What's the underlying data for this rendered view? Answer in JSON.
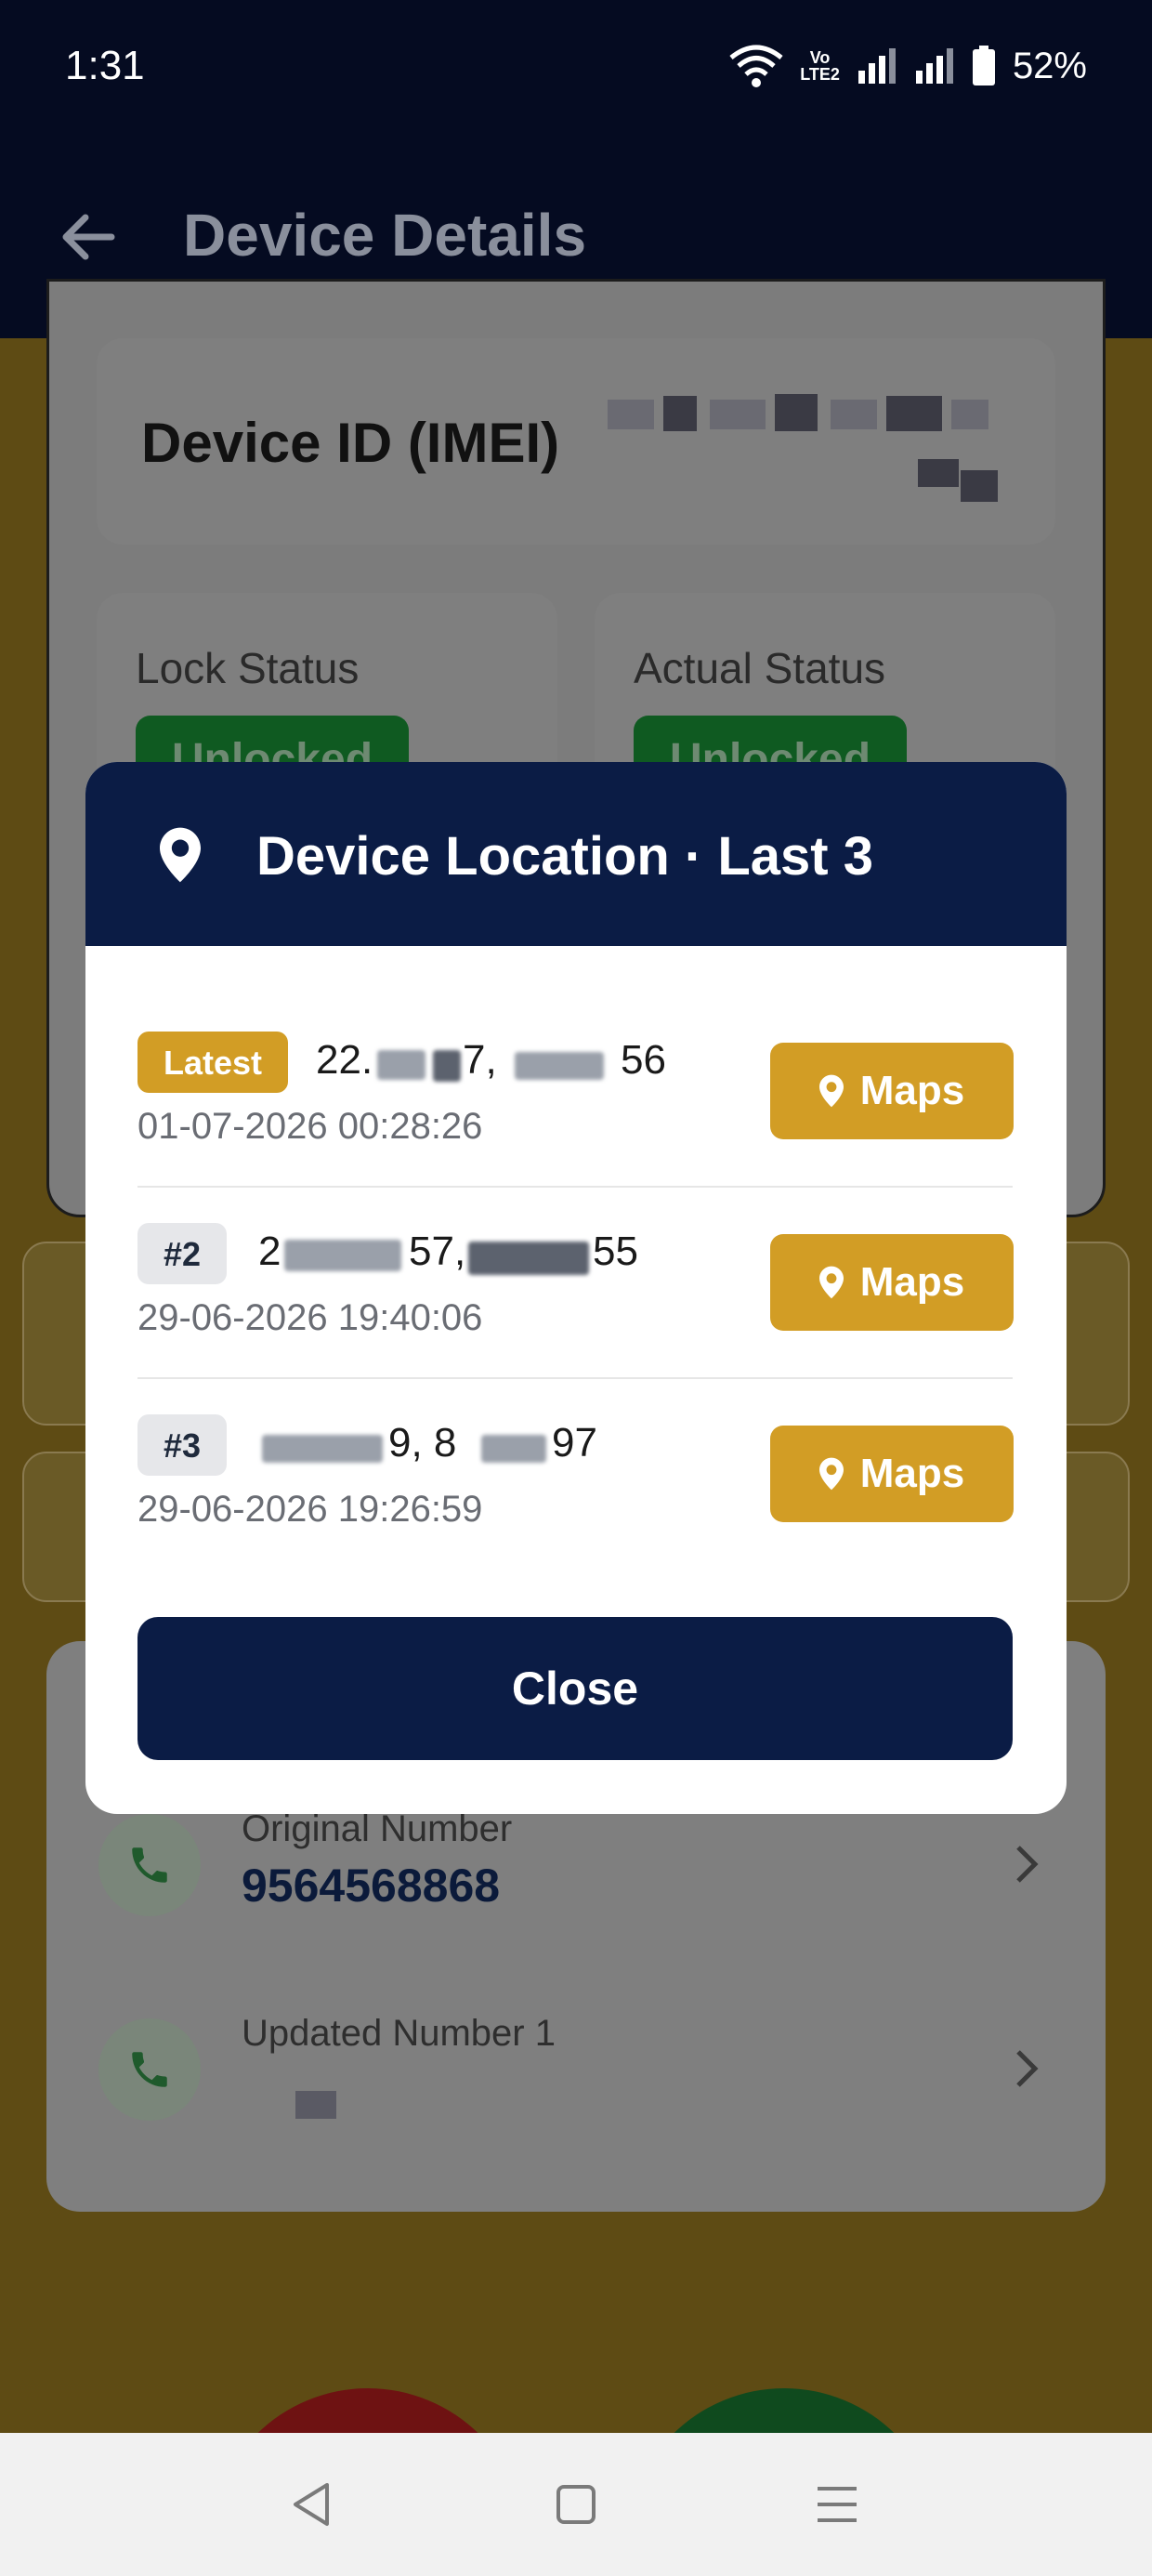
{
  "status_bar": {
    "time": "1:31",
    "battery": "52%",
    "network_label_top": "Vo",
    "network_label_bottom": "LTE2"
  },
  "app_bar": {
    "title": "Device Details",
    "back_icon": "arrow-back-icon"
  },
  "device": {
    "imei_label": "Device ID (IMEI)",
    "lock_status_label": "Lock Status",
    "lock_status_value": "Unlocked",
    "actual_status_label": "Actual Status",
    "actual_status_value": "Unlocked"
  },
  "phone_numbers": [
    {
      "label": "Original Number",
      "value": "9564568868"
    },
    {
      "label": "Updated Number 1",
      "value": ""
    }
  ],
  "dialog": {
    "title": "Device Location · Last 3",
    "title_icon": "location-pin-icon",
    "locations": [
      {
        "badge": "Latest",
        "coords_start": "22.",
        "coords_mid": "7,",
        "coords_end": "56",
        "timestamp": "01-07-2026 00:28:26",
        "maps_label": "Maps"
      },
      {
        "badge": "#2",
        "coords_start": "2",
        "coords_mid": "57,",
        "coords_end": "55",
        "timestamp": "29-06-2026 19:40:06",
        "maps_label": "Maps"
      },
      {
        "badge": "#3",
        "coords_start": "",
        "coords_mid": "9, 8",
        "coords_end": "97",
        "timestamp": "29-06-2026 19:26:59",
        "maps_label": "Maps"
      }
    ],
    "close_label": "Close"
  },
  "colors": {
    "navy": "#0b1c45",
    "gold": "#d29d25",
    "status_bar": "#050b21"
  },
  "nav_bar": {
    "back_icon": "nav-back-icon",
    "home_icon": "nav-home-icon",
    "menu_icon": "nav-menu-icon"
  }
}
